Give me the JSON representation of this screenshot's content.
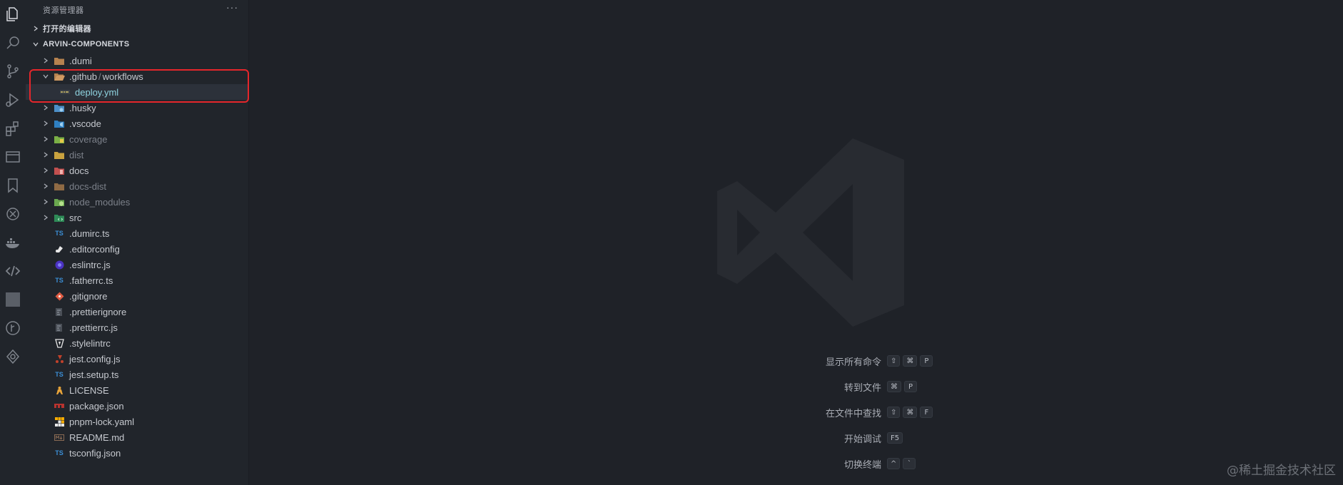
{
  "sidebar": {
    "title": "资源管理器",
    "more": "···",
    "open_editors": "打开的编辑器",
    "project": "ARVIN-COMPONENTS"
  },
  "tree": [
    {
      "label": ".dumi",
      "type": "folder",
      "icon": "folder-icon",
      "dim": false
    },
    {
      "label_a": ".github",
      "label_sep": "/",
      "label_b": "workflows",
      "type": "folder-open",
      "icon": "folder-open-icon"
    },
    {
      "label": "deploy.yml",
      "type": "file",
      "icon": "yaml-icon",
      "selected": true
    },
    {
      "label": ".husky",
      "type": "folder",
      "icon": "husky-folder-icon"
    },
    {
      "label": ".vscode",
      "type": "folder",
      "icon": "vscode-folder-icon"
    },
    {
      "label": "coverage",
      "type": "folder",
      "icon": "coverage-folder-icon",
      "dim": true
    },
    {
      "label": "dist",
      "type": "folder",
      "icon": "dist-folder-icon",
      "dim": true
    },
    {
      "label": "docs",
      "type": "folder",
      "icon": "docs-folder-icon"
    },
    {
      "label": "docs-dist",
      "type": "folder",
      "icon": "folder-icon",
      "dim": true
    },
    {
      "label": "node_modules",
      "type": "folder",
      "icon": "node-folder-icon",
      "dim": true
    },
    {
      "label": "src",
      "type": "folder",
      "icon": "src-folder-icon"
    },
    {
      "label": ".dumirc.ts",
      "type": "file",
      "icon": "ts-icon",
      "badge": "TS"
    },
    {
      "label": ".editorconfig",
      "type": "file",
      "icon": "editorconfig-icon"
    },
    {
      "label": ".eslintrc.js",
      "type": "file",
      "icon": "eslint-icon"
    },
    {
      "label": ".fatherrc.ts",
      "type": "file",
      "icon": "ts-icon",
      "badge": "TS"
    },
    {
      "label": ".gitignore",
      "type": "file",
      "icon": "git-icon"
    },
    {
      "label": ".prettierignore",
      "type": "file",
      "icon": "prettier-icon"
    },
    {
      "label": ".prettierrc.js",
      "type": "file",
      "icon": "prettier-icon"
    },
    {
      "label": ".stylelintrc",
      "type": "file",
      "icon": "stylelint-icon"
    },
    {
      "label": "jest.config.js",
      "type": "file",
      "icon": "jest-icon"
    },
    {
      "label": "jest.setup.ts",
      "type": "file",
      "icon": "ts-icon",
      "badge": "TS"
    },
    {
      "label": "LICENSE",
      "type": "file",
      "icon": "license-icon"
    },
    {
      "label": "package.json",
      "type": "file",
      "icon": "npm-icon"
    },
    {
      "label": "pnpm-lock.yaml",
      "type": "file",
      "icon": "pnpm-icon"
    },
    {
      "label": "README.md",
      "type": "file",
      "icon": "markdown-icon"
    },
    {
      "label": "tsconfig.json",
      "type": "file",
      "icon": "tsconfig-icon",
      "badge": "TS"
    }
  ],
  "shortcuts": [
    {
      "label": "显示所有命令",
      "keys": [
        "⇧",
        "⌘",
        "P"
      ]
    },
    {
      "label": "转到文件",
      "keys": [
        "⌘",
        "P"
      ]
    },
    {
      "label": "在文件中查找",
      "keys": [
        "⇧",
        "⌘",
        "F"
      ]
    },
    {
      "label": "开始调试",
      "keys": [
        "F5"
      ]
    },
    {
      "label": "切换终端",
      "keys": [
        "^",
        "`"
      ]
    }
  ],
  "watermark": "@稀土掘金技术社区",
  "colors": {
    "background": "#1f2228",
    "sidebar": "#21252b",
    "highlight": "#e5262b",
    "selected_text": "#8fd3e0"
  }
}
